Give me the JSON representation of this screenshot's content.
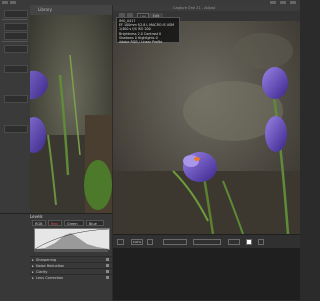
{
  "colors": {
    "panel": "#383838",
    "accent": "#e05050",
    "canvas_bg": "#2b2b2b"
  },
  "left_window": {
    "title": "Library"
  },
  "right_window": {
    "title": "Capture One 21 - Adjust",
    "toolbar": {
      "zoom": "100",
      "view_label": "Edit"
    }
  },
  "info_overlay": {
    "lines": [
      "IMG_0417",
      "EF 100mm f/2.8 L MACRO IS USM",
      "1/400 s  f/4  ISO 200",
      "Brightness 2.0  Contrast 0",
      "Shadows 0  Highlights 0",
      "Adobe RGB / Linear Profile"
    ]
  },
  "levels": {
    "title": "Levels",
    "channels": [
      "RGB",
      "Red",
      "Green",
      "Blue"
    ],
    "items": [
      "Sharpening",
      "Noise Reduction",
      "Clarity",
      "Lens Correction"
    ]
  },
  "image_tools": {
    "zoom_select": "100%"
  }
}
